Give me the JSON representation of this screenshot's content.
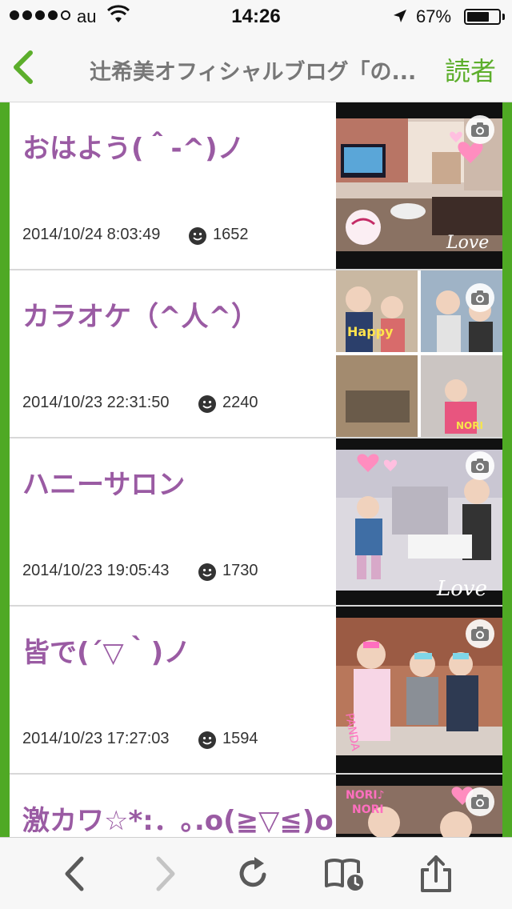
{
  "status_bar": {
    "carrier": "au",
    "time": "14:26",
    "battery_percent": "67%",
    "signal_bars_filled": 4,
    "signal_bars_total": 5,
    "battery_level": 0.67
  },
  "nav": {
    "title": "辻希美オフィシャルブログ「の...",
    "reader_label": "読者",
    "back_icon": "chevron-left-icon",
    "accent_color": "#5cae2b"
  },
  "colors": {
    "side_bars": "#4fa924",
    "title_purple": "#9a5ba3",
    "separator": "#d8d8d8"
  },
  "entries": [
    {
      "title": "おはよう(＾-^)ノ",
      "date": "2014/10/24 8:03:49",
      "count": "1652"
    },
    {
      "title": "カラオケ（^人^）",
      "date": "2014/10/23 22:31:50",
      "count": "2240"
    },
    {
      "title": "ハニーサロン",
      "date": "2014/10/23 19:05:43",
      "count": "1730"
    },
    {
      "title": "皆で(´▽｀)ノ",
      "date": "2014/10/23 17:27:03",
      "count": "1594"
    },
    {
      "title": "激カワ☆*:．｡.o(≧▽≦)o"
    }
  ],
  "toolbar": {
    "icons": [
      "back-arrow-icon",
      "forward-arrow-icon",
      "reload-icon",
      "bookmarks-icon",
      "share-icon"
    ]
  }
}
